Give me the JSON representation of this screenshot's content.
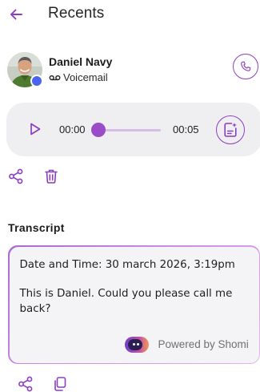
{
  "header": {
    "title": "Recents",
    "back_icon": "arrow-left-icon"
  },
  "contact": {
    "name": "Daniel Navy",
    "type_label": "Voicemail",
    "type_icon": "voicemail-icon",
    "presence_color": "#4a62f0",
    "call_icon": "phone-icon"
  },
  "player": {
    "play_icon": "play-icon",
    "current_time": "00:00",
    "duration": "00:05",
    "progress": 0.0,
    "transcribe_icon": "document-sparkle-icon"
  },
  "actions": {
    "share_icon": "share-icon",
    "delete_icon": "trash-icon"
  },
  "transcript": {
    "section_title": "Transcript",
    "date_line": "Date and Time: 30 march 2026, 3:19pm",
    "body": "This is Daniel. Could you please call me back?",
    "powered_by": "Powered by Shomi",
    "share_icon": "share-icon",
    "copy_icon": "copy-icon"
  },
  "colors": {
    "accent": "#8b3fbe",
    "slider_thumb": "#9a4cc8",
    "slider_track": "#d6bde6",
    "player_bg": "#efeff2"
  }
}
